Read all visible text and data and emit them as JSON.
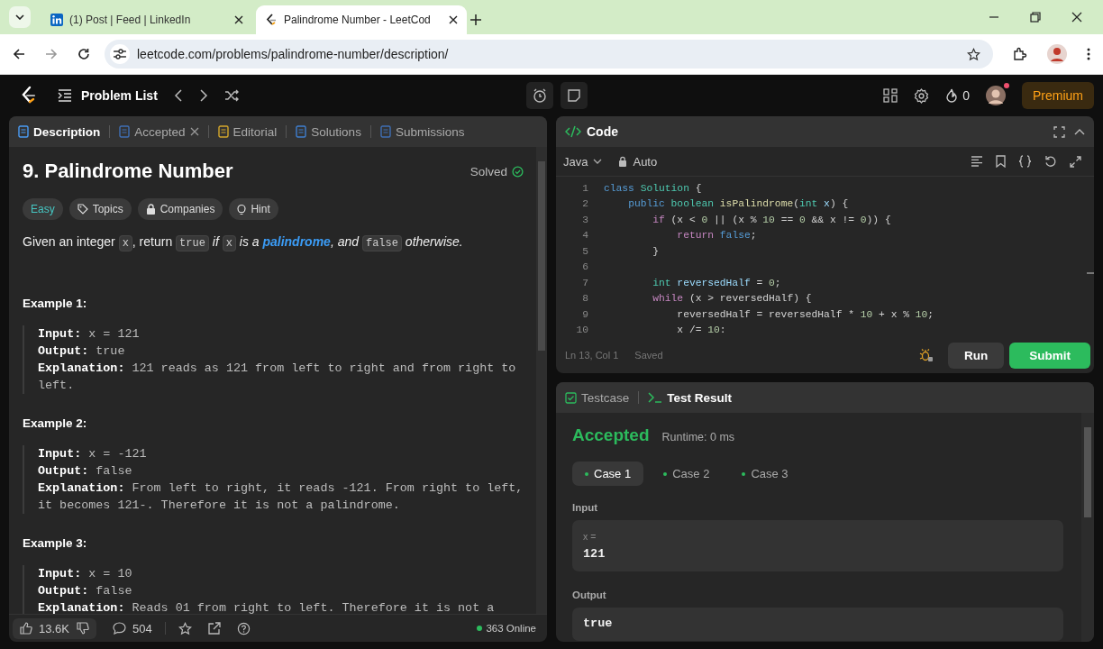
{
  "browser": {
    "tabs": [
      {
        "title": "(1) Post | Feed | LinkedIn",
        "selected": false,
        "kind": "linkedin"
      },
      {
        "title": "Palindrome Number - LeetCod",
        "selected": true,
        "kind": "leetcode"
      }
    ],
    "address": "leetcode.com/problems/palindrome-number/description/"
  },
  "navbar": {
    "problem_list": "Problem List",
    "streak": "0",
    "premium": "Premium",
    "notification": true
  },
  "description_panel": {
    "tabs": [
      {
        "label": "Description",
        "selected": true,
        "closable": false,
        "kind": "description"
      },
      {
        "label": "Accepted",
        "selected": false,
        "closable": true,
        "kind": "accepted"
      },
      {
        "label": "Editorial",
        "selected": false,
        "closable": false,
        "kind": "editorial"
      },
      {
        "label": "Solutions",
        "selected": false,
        "closable": false,
        "kind": "solutions"
      },
      {
        "label": "Submissions",
        "selected": false,
        "closable": false,
        "kind": "submissions"
      }
    ],
    "title": "9. Palindrome Number",
    "status": "Solved",
    "tags": [
      {
        "label": "Easy",
        "kind": "difficulty"
      },
      {
        "label": "Topics",
        "kind": "topics"
      },
      {
        "label": "Companies",
        "kind": "companies"
      },
      {
        "label": "Hint",
        "kind": "hint"
      }
    ],
    "statement": [
      {
        "text": "Given an integer ",
        "kind": "plain"
      },
      {
        "text": "x",
        "kind": "code"
      },
      {
        "text": ", return ",
        "kind": "plain"
      },
      {
        "text": "true",
        "kind": "code"
      },
      {
        "text": " if ",
        "kind": "italic"
      },
      {
        "text": "x",
        "kind": "code"
      },
      {
        "text": " is a ",
        "kind": "italic"
      },
      {
        "text": "palindrome",
        "kind": "link"
      },
      {
        "text": ", and ",
        "kind": "italic"
      },
      {
        "text": "false",
        "kind": "code"
      },
      {
        "text": " otherwise.",
        "kind": "italic"
      }
    ],
    "examples": [
      {
        "heading": "Example 1:",
        "lines": [
          {
            "label": "Input:",
            "value": "x = 121"
          },
          {
            "label": "Output:",
            "value": "true"
          },
          {
            "label": "Explanation:",
            "value": "121 reads as 121 from left to right and from right to left."
          }
        ]
      },
      {
        "heading": "Example 2:",
        "lines": [
          {
            "label": "Input:",
            "value": "x = -121"
          },
          {
            "label": "Output:",
            "value": "false"
          },
          {
            "label": "Explanation:",
            "value": "From left to right, it reads -121. From right to left, it becomes 121-. Therefore it is not a palindrome."
          }
        ]
      },
      {
        "heading": "Example 3:",
        "lines": [
          {
            "label": "Input:",
            "value": "x = 10"
          },
          {
            "label": "Output:",
            "value": "false"
          },
          {
            "label": "Explanation:",
            "value": "Reads 01 from right to left. Therefore it is not a"
          }
        ]
      }
    ],
    "footer": {
      "likes": "13.6K",
      "comments": "504",
      "online": "363 Online"
    }
  },
  "code_panel": {
    "title": "Code",
    "language": "Java",
    "mode": "Auto",
    "lines": [
      {
        "number": "1",
        "text": "class Solution {"
      },
      {
        "number": "2",
        "text": "    public boolean isPalindrome(int x) {"
      },
      {
        "number": "3",
        "text": "        if (x < 0 || (x % 10 == 0 && x != 0)) {"
      },
      {
        "number": "4",
        "text": "            return false;"
      },
      {
        "number": "5",
        "text": "        }"
      },
      {
        "number": "6"
      },
      {
        "number": "7",
        "text": "        int reversedHalf = 0;"
      },
      {
        "number": "8",
        "text": "        while (x > reversedHalf) {"
      },
      {
        "number": "9",
        "text": "            reversedHalf = reversedHalf * 10 + x % 10;"
      },
      {
        "number": "10",
        "text": "            x /= 10:"
      }
    ],
    "cursor": "Ln 13, Col 1",
    "save_state": "Saved",
    "run": "Run",
    "submit": "Submit"
  },
  "result_panel": {
    "tabs": [
      {
        "label": "Testcase",
        "selected": false,
        "kind": "testcase"
      },
      {
        "label": "Test Result",
        "selected": true,
        "kind": "result"
      }
    ],
    "verdict": "Accepted",
    "runtime": "Runtime: 0 ms",
    "cases": [
      {
        "label": "Case 1",
        "selected": true
      },
      {
        "label": "Case 2",
        "selected": false
      },
      {
        "label": "Case 3",
        "selected": false
      }
    ],
    "input_label": "Input",
    "input_var": "x =",
    "input_value": "121",
    "output_label": "Output",
    "output_value": "true"
  }
}
